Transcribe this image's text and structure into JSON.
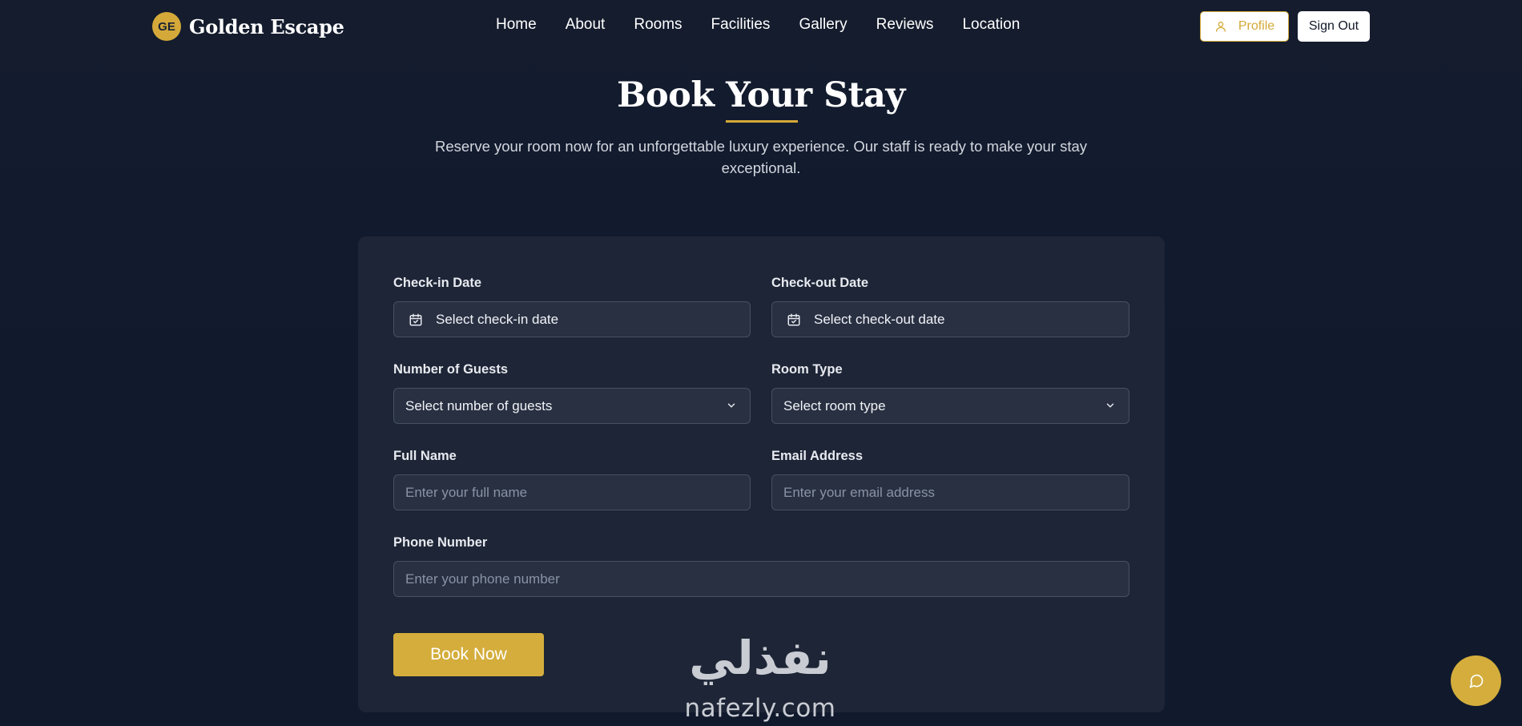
{
  "brand": {
    "initials": "GE",
    "name": "Golden Escape"
  },
  "nav": {
    "links": [
      "Home",
      "About",
      "Rooms",
      "Facilities",
      "Gallery",
      "Reviews",
      "Location"
    ],
    "profile_label": "Profile",
    "signout_label": "Sign Out"
  },
  "hero": {
    "title": "Book Your Stay",
    "subtitle": "Reserve your room now for an unforgettable luxury experience. Our staff is ready to make your stay exceptional."
  },
  "form": {
    "checkin": {
      "label": "Check-in Date",
      "value": "Select check-in date",
      "icon": "calendar-icon"
    },
    "checkout": {
      "label": "Check-out Date",
      "value": "Select check-out date",
      "icon": "calendar-icon"
    },
    "guests": {
      "label": "Number of Guests",
      "value": "Select number of guests"
    },
    "room": {
      "label": "Room Type",
      "value": "Select room type"
    },
    "fullname": {
      "label": "Full Name",
      "placeholder": "Enter your full name"
    },
    "email": {
      "label": "Email Address",
      "placeholder": "Enter your email address"
    },
    "phone": {
      "label": "Phone Number",
      "placeholder": "Enter your phone number"
    },
    "submit_label": "Book Now"
  },
  "watermark": {
    "arabic": "نفذلي",
    "latin": "nafezly.com"
  },
  "colors": {
    "gold": "#d4ad3c",
    "background": "#111a2d",
    "card": "#1d2536",
    "field": "#283042"
  }
}
